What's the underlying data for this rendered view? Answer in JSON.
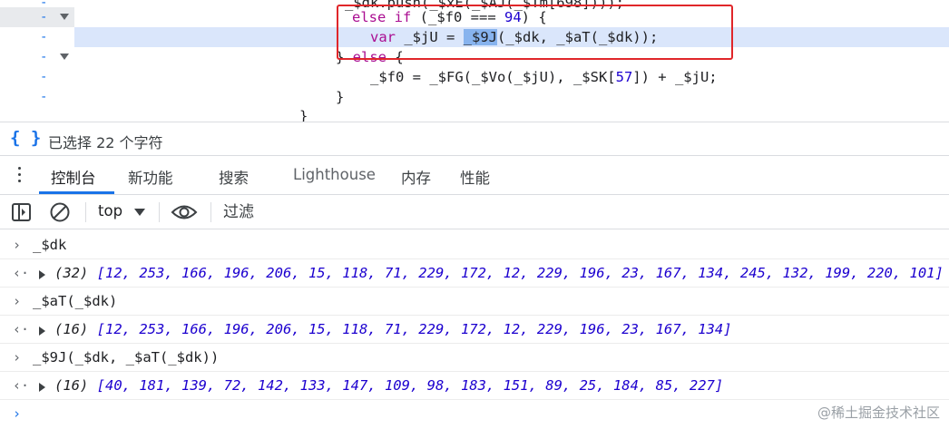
{
  "editor": {
    "lines": [
      {
        "text_a": "_$dk.push(_$xE(_$AJ(_$Tm[698])));"
      },
      {
        "kw": "else if",
        "text_a": " (_$f0 === ",
        "num": "94",
        "text_b": ") {"
      },
      {
        "kw": "var",
        "text_a": " _$jU = ",
        "sel": "_$9J",
        "text_b": "(_$dk, _$aT(_$dk));"
      },
      {
        "text_a": "} ",
        "kw": "else",
        "text_b": " {"
      },
      {
        "text_a": "_$f0 = _$FG(_$Vo(_$jU), _$SK[",
        "num": "57",
        "text_b": "]) + _$jU;"
      },
      {
        "text_a": "}"
      },
      {
        "text_a": "}"
      }
    ],
    "gutter_marker": "-"
  },
  "status": {
    "braces": "{ }",
    "text": "已选择 22 个字符"
  },
  "tabs": [
    {
      "label": "控制台"
    },
    {
      "label": "新功能"
    },
    {
      "label": "搜索"
    },
    {
      "label": "Lighthouse"
    },
    {
      "label": "内存"
    },
    {
      "label": "性能"
    }
  ],
  "toolbar": {
    "context": "top",
    "filter_placeholder": "过滤"
  },
  "console": {
    "prompt_symbol": "›",
    "return_symbol": "‹·",
    "input_caret": "›",
    "entries": [
      {
        "input": "_$dk"
      },
      {
        "count": "(32)",
        "values": "[12, 253, 166, 196, 206, 15, 118, 71, 229, 172, 12, 229, 196, 23, 167, 134, 245, 132, 199, 220, 101]"
      },
      {
        "input": "_$aT(_$dk)"
      },
      {
        "count": "(16)",
        "values": "[12, 253, 166, 196, 206, 15, 118, 71, 229, 172, 12, 229, 196, 23, 167, 134]"
      },
      {
        "input": "_$9J(_$dk, _$aT(_$dk))"
      },
      {
        "count": "(16)",
        "values": "[40, 181, 139, 72, 142, 133, 147, 109, 98, 183, 151, 89, 25, 184, 85, 227]"
      }
    ]
  },
  "watermark": "@稀土掘金技术社区"
}
